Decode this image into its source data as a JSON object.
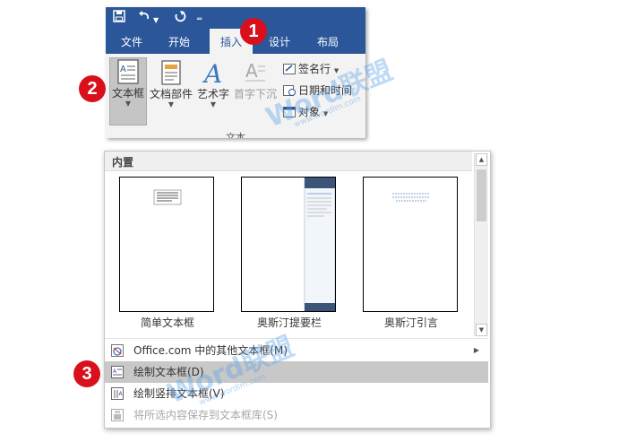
{
  "ribbon": {
    "qat": {
      "save_icon": "save-icon",
      "undo_icon": "undo-icon",
      "redo_icon": "redo-icon",
      "customize_icon": "customize-qat-icon"
    },
    "tabs": [
      "文件",
      "开始",
      "插入",
      "设计",
      "布局"
    ],
    "active_tab": "插入",
    "buttons": {
      "textbox": "文本框",
      "quick_parts": "文档部件",
      "wordart": "艺术字",
      "drop_cap": "首字下沉"
    },
    "small_buttons": {
      "signature_line": "签名行",
      "date_time": "日期和时间",
      "object": "对象"
    },
    "group_label": "文本"
  },
  "badges": [
    "1",
    "2",
    "3"
  ],
  "gallery": {
    "header": "内置",
    "thumbnails": [
      {
        "caption": "简单文本框"
      },
      {
        "caption": "奥斯汀提要栏"
      },
      {
        "caption": "奥斯汀引言"
      }
    ]
  },
  "menu": {
    "items": [
      {
        "label": "Office.com 中的其他文本框(M)",
        "state": "normal",
        "has_submenu": true
      },
      {
        "label": "绘制文本框(D)",
        "state": "highlighted",
        "has_submenu": false
      },
      {
        "label": "绘制竖排文本框(V)",
        "state": "normal",
        "has_submenu": false
      },
      {
        "label": "将所选内容保存到文本框库(S)",
        "state": "disabled",
        "has_submenu": false
      }
    ]
  },
  "watermark": {
    "brand": "Word联盟",
    "url": "www.wordlm.com"
  },
  "colors": {
    "ribbon_blue": "#2b579a",
    "badge_red": "#d9101c",
    "highlight_gray": "#c8c8c8"
  }
}
